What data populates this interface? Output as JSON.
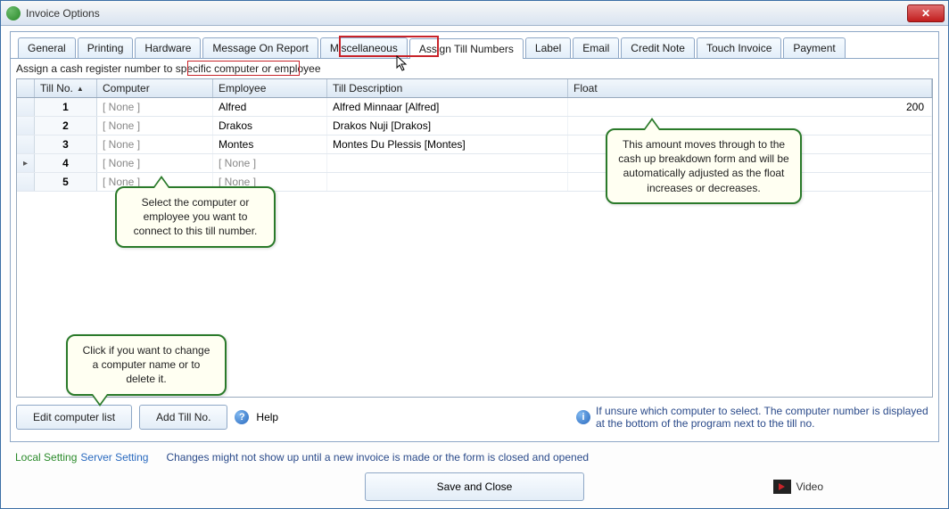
{
  "window": {
    "title": "Invoice Options"
  },
  "tabs": [
    "General",
    "Printing",
    "Hardware",
    "Message On Report",
    "Miscellaneous",
    "Assign Till Numbers",
    "Label",
    "Email",
    "Credit Note",
    "Touch Invoice",
    "Payment"
  ],
  "active_tab": 5,
  "instruction": "Assign a cash register number to specific computer or employee",
  "columns": {
    "tillno": "Till No.",
    "computer": "Computer",
    "employee": "Employee",
    "desc": "Till Description",
    "float": "Float"
  },
  "rows": [
    {
      "till": "1",
      "computer": "[ None ]",
      "employee": "Alfred",
      "desc": "Alfred Minnaar [Alfred]",
      "float": "200",
      "sel": ""
    },
    {
      "till": "2",
      "computer": "[ None ]",
      "employee": "Drakos",
      "desc": "Drakos Nuji [Drakos]",
      "float": "",
      "sel": ""
    },
    {
      "till": "3",
      "computer": "[ None ]",
      "employee": "Montes",
      "desc": "Montes Du Plessis [Montes]",
      "float": "",
      "sel": ""
    },
    {
      "till": "4",
      "computer": "[ None ]",
      "employee": "[ None ]",
      "desc": "",
      "float": "",
      "sel": "▸"
    },
    {
      "till": "5",
      "computer": "[ None ]",
      "employee": "[ None ]",
      "desc": "",
      "float": "",
      "sel": ""
    }
  ],
  "callouts": {
    "select": "Select the computer or employee you want to connect to this till number.",
    "float": "This amount moves through to the cash up breakdown form and will be automatically adjusted as the float increases or decreases.",
    "edit": "Click if you want to change a computer name or to delete it."
  },
  "buttons": {
    "edit": "Edit computer list",
    "add": "Add Till No.",
    "help": "Help",
    "save": "Save and Close",
    "video": "Video"
  },
  "info_text": "If unsure which computer to select. The computer number is displayed at the bottom of the program next to the till no.",
  "settings": {
    "local": "Local Setting",
    "server": "Server Setting",
    "note": "Changes might not show up until a new invoice is made or the form is closed and opened"
  }
}
